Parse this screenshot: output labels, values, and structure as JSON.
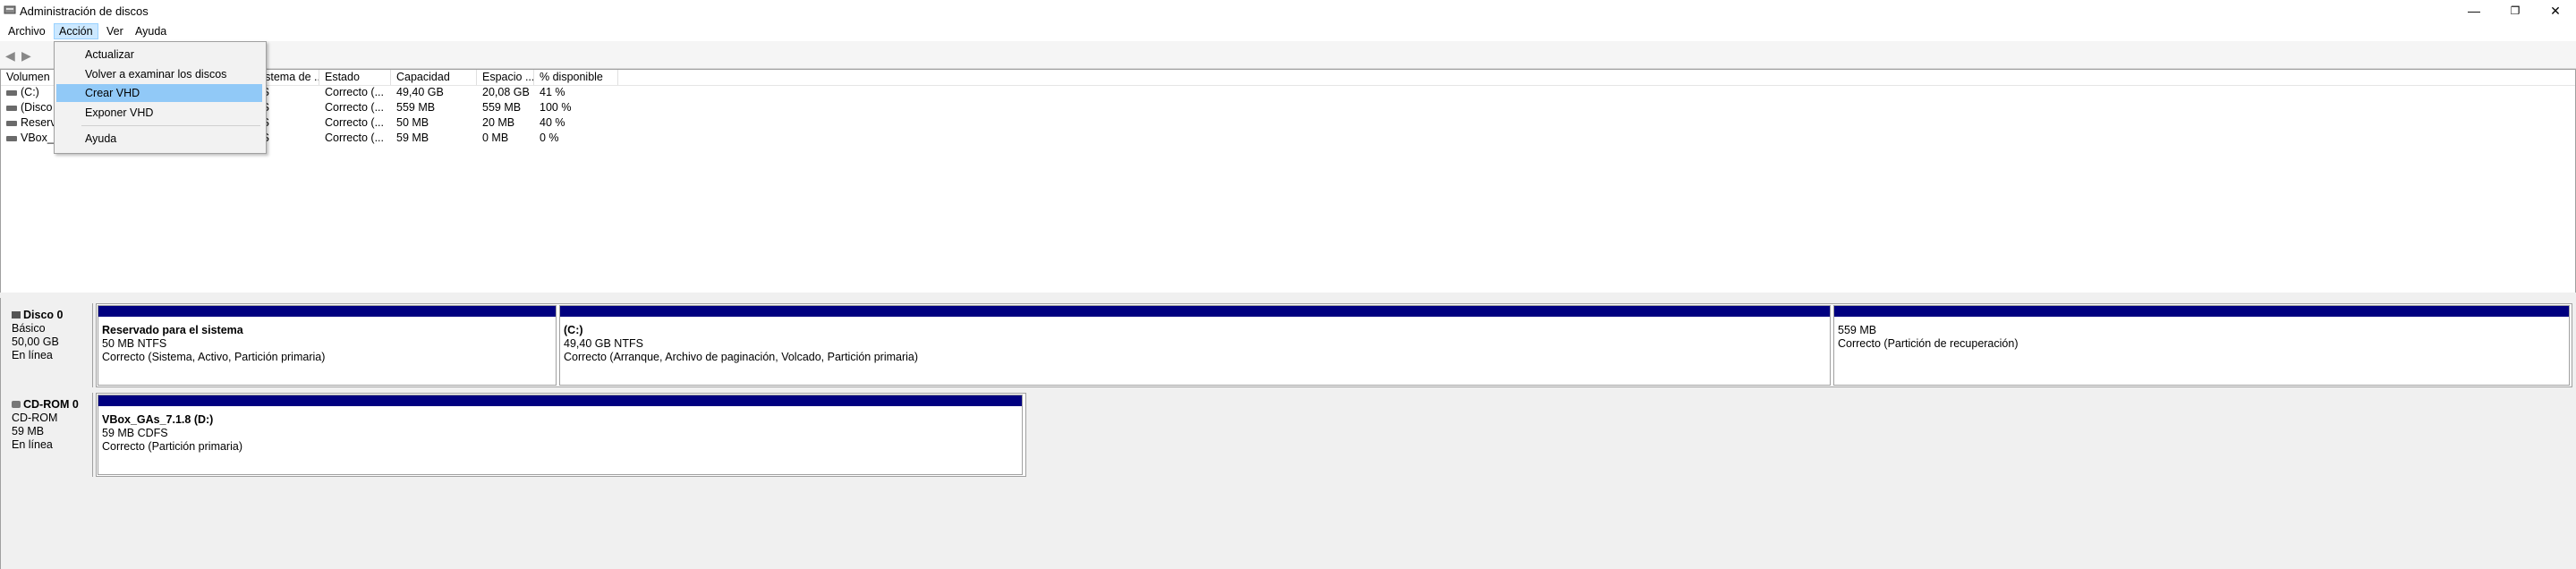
{
  "window": {
    "title": "Administración de discos"
  },
  "menubar": {
    "items": [
      "Archivo",
      "Acción",
      "Ver",
      "Ayuda"
    ]
  },
  "action_menu": {
    "items": [
      "Actualizar",
      "Volver a examinar los discos",
      "Crear VHD",
      "Exponer VHD",
      "Ayuda"
    ],
    "highlighted": "Crear VHD"
  },
  "volume_table": {
    "columns": [
      "Volumen",
      "Sistema de ...",
      "Estado",
      "Capacidad",
      "Espacio ...",
      "% disponible"
    ],
    "rows": [
      {
        "volume": "(C:)",
        "fs": "FS",
        "status": "Correcto (...",
        "capacity": "49,40 GB",
        "free": "20,08 GB",
        "pct": "41 %"
      },
      {
        "volume": "(Disco ...",
        "fs": "FS",
        "status": "Correcto (...",
        "capacity": "559 MB",
        "free": "559 MB",
        "pct": "100 %"
      },
      {
        "volume": "Reserva...",
        "fs": "FS",
        "status": "Correcto (...",
        "capacity": "50 MB",
        "free": "20 MB",
        "pct": "40 %"
      },
      {
        "volume": "VBox_G...",
        "fs": "FS",
        "status": "Correcto (...",
        "capacity": "59 MB",
        "free": "0 MB",
        "pct": "0 %"
      }
    ]
  },
  "disks": [
    {
      "name": "Disco 0",
      "type": "Básico",
      "size": "50,00 GB",
      "state": "En línea",
      "partitions": [
        {
          "name": "Reservado para el sistema",
          "size": "50 MB NTFS",
          "status": "Correcto (Sistema, Activo, Partición primaria)"
        },
        {
          "name": "(C:)",
          "size": "49,40 GB NTFS",
          "status": "Correcto (Arranque, Archivo de paginación, Volcado, Partición primaria)"
        },
        {
          "name": "",
          "size": "559 MB",
          "status": "Correcto (Partición de recuperación)"
        }
      ]
    },
    {
      "name": "CD-ROM 0",
      "type": "CD-ROM",
      "size": "59 MB",
      "state": "En línea",
      "partitions": [
        {
          "name": "VBox_GAs_7.1.8  (D:)",
          "size": "59 MB CDFS",
          "status": "Correcto (Partición primaria)"
        }
      ]
    }
  ],
  "icons": {
    "back": "back-arrow-icon",
    "forward": "forward-arrow-icon",
    "minimize": "minimize-icon",
    "restore": "restore-icon",
    "close": "close-icon"
  },
  "colors": {
    "partition_bar": "#000080",
    "menu_highlight": "#91c9f7"
  }
}
